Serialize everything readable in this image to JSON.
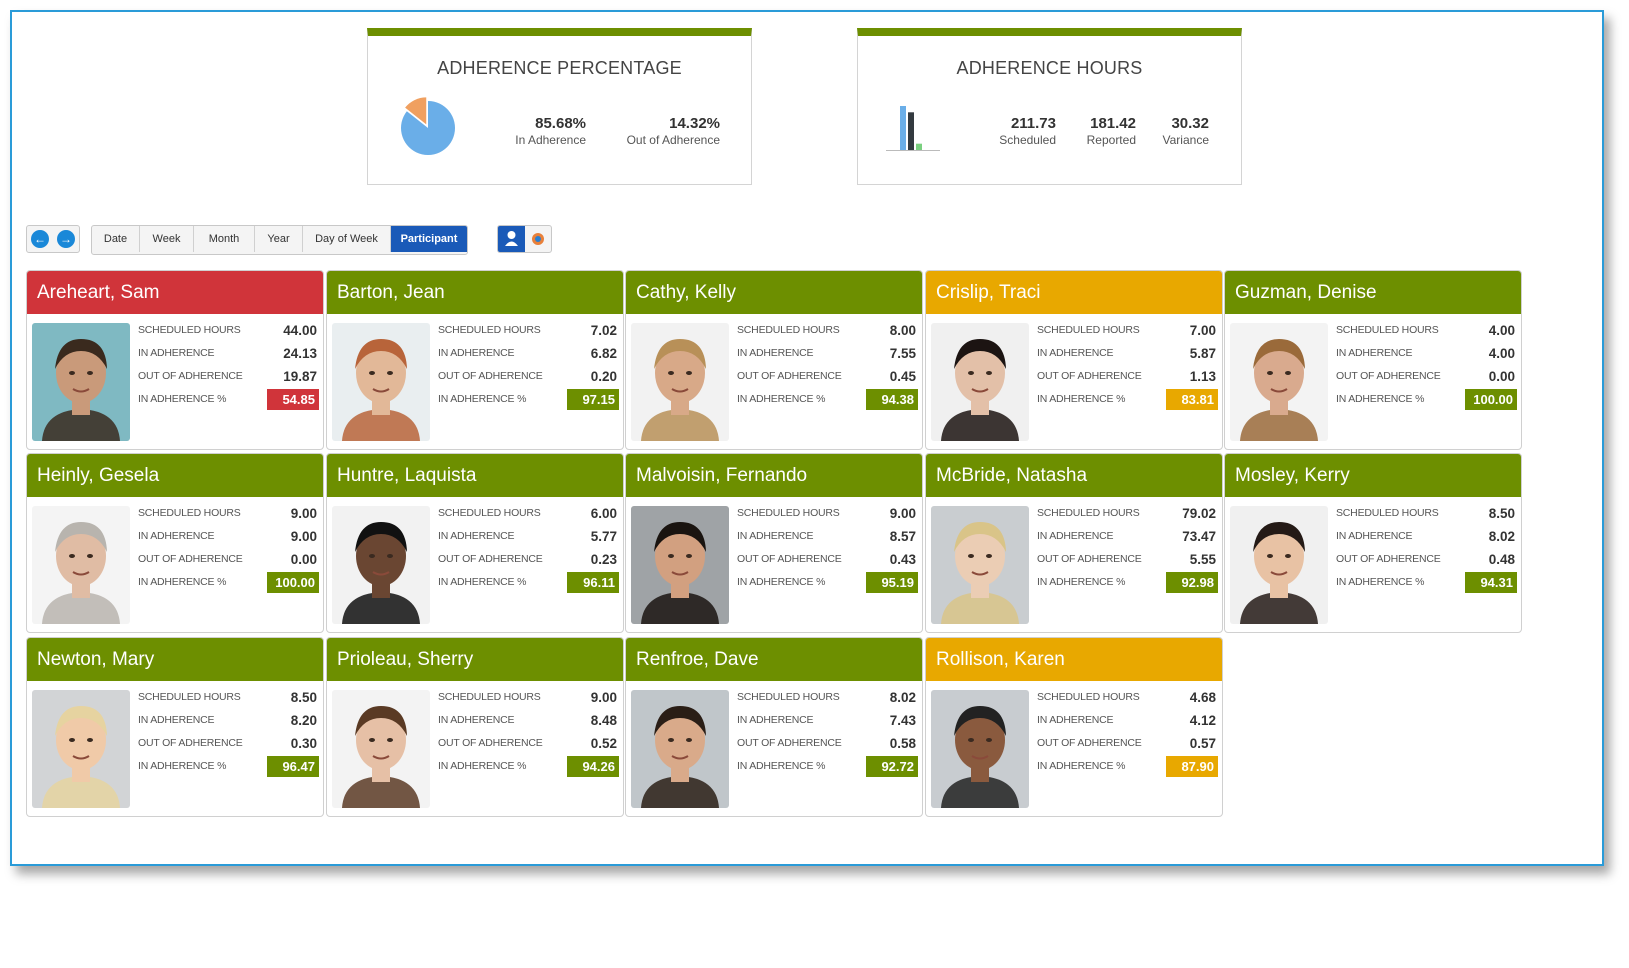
{
  "colors": {
    "green": "#6d8f00",
    "red": "#d0343a",
    "orange": "#e8a800",
    "blue": "#1a5ab8",
    "frame": "#2a9bd8"
  },
  "summary_percentage": {
    "title": "ADHERENCE PERCENTAGE",
    "in_value": "85.68%",
    "in_label": "In Adherence",
    "out_value": "14.32%",
    "out_label": "Out of Adherence",
    "pie_fractions": [
      0.8568,
      0.1432
    ]
  },
  "summary_hours": {
    "title": "ADHERENCE HOURS",
    "scheduled_value": "211.73",
    "scheduled_label": "Scheduled",
    "reported_value": "181.42",
    "reported_label": "Reported",
    "variance_value": "30.32",
    "variance_label": "Variance",
    "bar_values": [
      211.73,
      181.42,
      30.32
    ]
  },
  "nav": {
    "prev_icon": "arrow-left-icon",
    "next_icon": "arrow-right-icon"
  },
  "tabs": [
    "Date",
    "Week",
    "Month",
    "Year",
    "Day of Week",
    "Participant"
  ],
  "active_tab": "Participant",
  "view_toggles": [
    "person-icon",
    "pie-icon"
  ],
  "labels": {
    "scheduled": "SCHEDULED HOURS",
    "in_adherence": "IN ADHERENCE",
    "out_of_adherence": "OUT OF ADHERENCE",
    "in_adherence_pct": "IN ADHERENCE %"
  },
  "participants": [
    {
      "name": "Areheart, Sam",
      "scheduled": "44.00",
      "in_adherence": "24.13",
      "out_of_adherence": "19.87",
      "pct": "54.85",
      "status": "red"
    },
    {
      "name": "Barton, Jean",
      "scheduled": "7.02",
      "in_adherence": "6.82",
      "out_of_adherence": "0.20",
      "pct": "97.15",
      "status": "green"
    },
    {
      "name": "Cathy, Kelly",
      "scheduled": "8.00",
      "in_adherence": "7.55",
      "out_of_adherence": "0.45",
      "pct": "94.38",
      "status": "green"
    },
    {
      "name": "Crislip, Traci",
      "scheduled": "7.00",
      "in_adherence": "5.87",
      "out_of_adherence": "1.13",
      "pct": "83.81",
      "status": "orange"
    },
    {
      "name": "Guzman, Denise",
      "scheduled": "4.00",
      "in_adherence": "4.00",
      "out_of_adherence": "0.00",
      "pct": "100.00",
      "status": "green"
    },
    {
      "name": "Heinly, Gesela",
      "scheduled": "9.00",
      "in_adherence": "9.00",
      "out_of_adherence": "0.00",
      "pct": "100.00",
      "status": "green"
    },
    {
      "name": "Huntre, Laquista",
      "scheduled": "6.00",
      "in_adherence": "5.77",
      "out_of_adherence": "0.23",
      "pct": "96.11",
      "status": "green"
    },
    {
      "name": "Malvoisin, Fernando",
      "scheduled": "9.00",
      "in_adherence": "8.57",
      "out_of_adherence": "0.43",
      "pct": "95.19",
      "status": "green"
    },
    {
      "name": "McBride, Natasha",
      "scheduled": "79.02",
      "in_adherence": "73.47",
      "out_of_adherence": "5.55",
      "pct": "92.98",
      "status": "green"
    },
    {
      "name": "Mosley, Kerry",
      "scheduled": "8.50",
      "in_adherence": "8.02",
      "out_of_adherence": "0.48",
      "pct": "94.31",
      "status": "green"
    },
    {
      "name": "Newton, Mary",
      "scheduled": "8.50",
      "in_adherence": "8.20",
      "out_of_adherence": "0.30",
      "pct": "96.47",
      "status": "green"
    },
    {
      "name": "Prioleau, Sherry",
      "scheduled": "9.00",
      "in_adherence": "8.48",
      "out_of_adherence": "0.52",
      "pct": "94.26",
      "status": "green"
    },
    {
      "name": "Renfroe, Dave",
      "scheduled": "8.02",
      "in_adherence": "7.43",
      "out_of_adherence": "0.58",
      "pct": "92.72",
      "status": "green"
    },
    {
      "name": "Rollison, Karen",
      "scheduled": "4.68",
      "in_adherence": "4.12",
      "out_of_adherence": "0.57",
      "pct": "87.90",
      "status": "orange"
    }
  ]
}
